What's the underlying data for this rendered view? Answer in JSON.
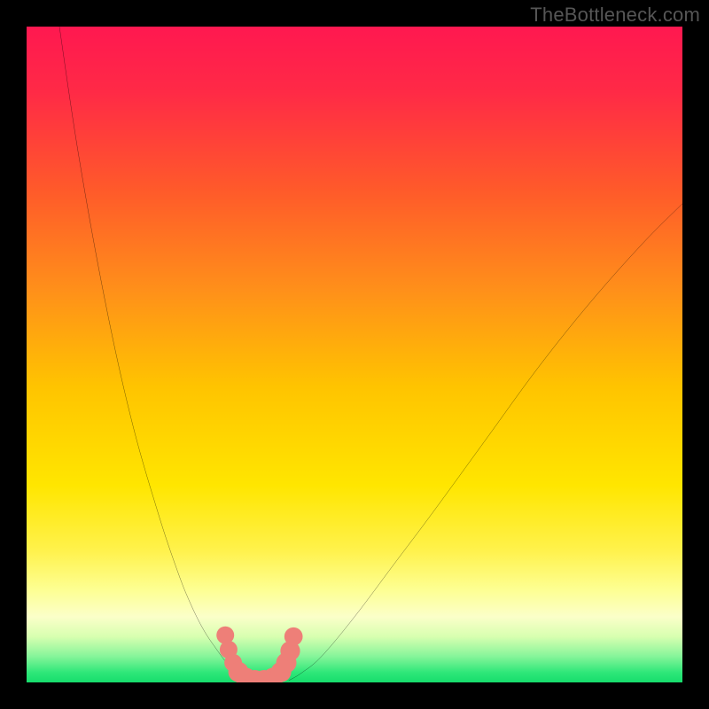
{
  "watermark": "TheBottleneck.com",
  "gradient_stops": [
    {
      "offset": 0.0,
      "color": "#ff1850"
    },
    {
      "offset": 0.1,
      "color": "#ff2a46"
    },
    {
      "offset": 0.25,
      "color": "#ff5a2a"
    },
    {
      "offset": 0.4,
      "color": "#ff8f1a"
    },
    {
      "offset": 0.55,
      "color": "#ffc400"
    },
    {
      "offset": 0.7,
      "color": "#ffe600"
    },
    {
      "offset": 0.8,
      "color": "#fff24d"
    },
    {
      "offset": 0.86,
      "color": "#fdff94"
    },
    {
      "offset": 0.9,
      "color": "#fbffc9"
    },
    {
      "offset": 0.93,
      "color": "#d8ffb0"
    },
    {
      "offset": 0.96,
      "color": "#87f59a"
    },
    {
      "offset": 0.985,
      "color": "#2ee779"
    },
    {
      "offset": 1.0,
      "color": "#17dd6c"
    }
  ],
  "chart_data": {
    "type": "line",
    "title": "",
    "xlabel": "",
    "ylabel": "",
    "xlim": [
      0,
      100
    ],
    "ylim": [
      0,
      100
    ],
    "series": [
      {
        "name": "left-curve",
        "x": [
          5,
          8,
          12,
          16,
          20,
          23,
          25,
          27,
          29,
          30.5,
          32,
          33,
          34
        ],
        "values": [
          100,
          80,
          58,
          40,
          26,
          17,
          12,
          8,
          5,
          3,
          1.5,
          0.7,
          0.3
        ]
      },
      {
        "name": "right-curve",
        "x": [
          40,
          42,
          45,
          50,
          56,
          62,
          70,
          78,
          86,
          94,
          100
        ],
        "values": [
          0.3,
          1.5,
          4,
          10,
          18,
          26,
          37,
          48,
          58,
          67,
          73
        ]
      },
      {
        "name": "bottom-connector",
        "x": [
          30.5,
          31.5,
          33,
          34.5,
          36,
          37.5,
          39,
          40
        ],
        "values": [
          3.0,
          1.4,
          0.6,
          0.4,
          0.4,
          0.6,
          1.4,
          3.0
        ]
      }
    ],
    "markers": [
      {
        "x": 30.3,
        "y": 7.2,
        "r": 1.35
      },
      {
        "x": 30.8,
        "y": 5.0,
        "r": 1.35
      },
      {
        "x": 31.5,
        "y": 3.0,
        "r": 1.35
      },
      {
        "x": 32.3,
        "y": 1.6,
        "r": 1.55
      },
      {
        "x": 33.4,
        "y": 0.7,
        "r": 1.55
      },
      {
        "x": 34.8,
        "y": 0.35,
        "r": 1.55
      },
      {
        "x": 36.2,
        "y": 0.35,
        "r": 1.55
      },
      {
        "x": 37.6,
        "y": 0.7,
        "r": 1.55
      },
      {
        "x": 38.8,
        "y": 1.6,
        "r": 1.55
      },
      {
        "x": 39.6,
        "y": 3.0,
        "r": 1.55
      },
      {
        "x": 40.2,
        "y": 4.8,
        "r": 1.5
      },
      {
        "x": 40.7,
        "y": 7.0,
        "r": 1.4
      }
    ],
    "marker_color": "#ee7f78",
    "curve_color": "#000000",
    "curve_width": 2.0
  }
}
